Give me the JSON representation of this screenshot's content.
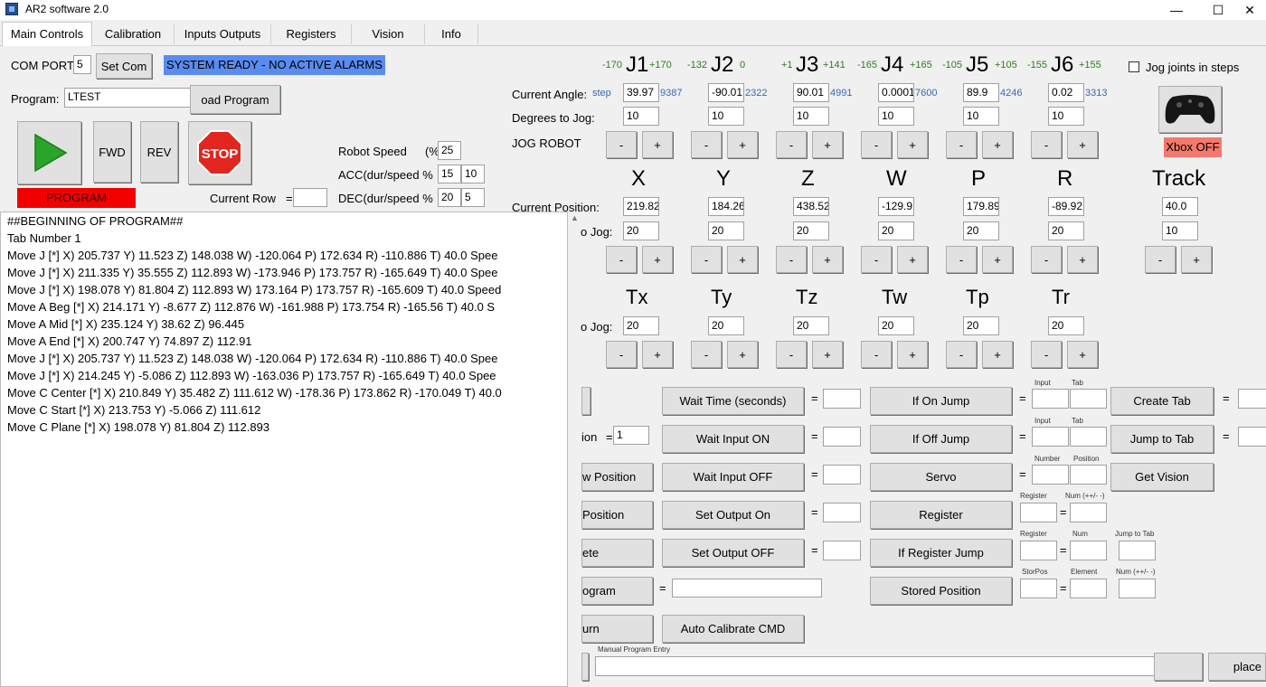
{
  "window": {
    "title": "AR2 software 2.0",
    "minimize": "—",
    "maximize": "☐",
    "close": "✕"
  },
  "tabs": [
    "Main Controls",
    "Calibration",
    "Inputs Outputs",
    "Registers",
    "Vision",
    "Info"
  ],
  "com": {
    "label": "COM PORT",
    "value": "5",
    "button": "Set Com",
    "status": "SYSTEM READY - NO ACTIVE ALARMS"
  },
  "program": {
    "label": "Program:",
    "value": "LTEST",
    "load_button": "oad Program"
  },
  "run": {
    "fwd": "FWD",
    "rev": "REV",
    "stop": "STOP",
    "status": "PROGRAM STOPPED",
    "current_row_label": "Current Row",
    "current_row_eq": "=",
    "current_row_value": ""
  },
  "speed": {
    "speed_label": "Robot Speed",
    "speed_pct": "(%",
    "speed_value": "25",
    "acc_label": "ACC(dur/speed %",
    "acc_dur": "15",
    "acc_speed": "10",
    "dec_label": "DEC(dur/speed %",
    "dec_dur": "20",
    "dec_speed": "5"
  },
  "joints": [
    {
      "name": "J1",
      "min": "-170",
      "max": "+170",
      "angle": "39.97",
      "extra": "9387",
      "jog": "10"
    },
    {
      "name": "J2",
      "min": "-132",
      "max": "0",
      "angle": "-90.01",
      "extra": "2322",
      "jog": "10"
    },
    {
      "name": "J3",
      "min": "+1",
      "max": "+141",
      "angle": "90.01",
      "extra": "4991",
      "jog": "10"
    },
    {
      "name": "J4",
      "min": "-165",
      "max": "+165",
      "angle": "0.0001",
      "extra": "7600",
      "jog": "10"
    },
    {
      "name": "J5",
      "min": "-105",
      "max": "+105",
      "angle": "89.9",
      "extra": "4246",
      "jog": "10"
    },
    {
      "name": "J6",
      "min": "-155",
      "max": "+155",
      "angle": "0.02",
      "extra": "3313",
      "jog": "10"
    }
  ],
  "jog_labels": {
    "current_angle": "Current Angle:",
    "step": "step",
    "degrees_to_jog": "Degrees to Jog:",
    "jog_robot": "JOG ROBOT",
    "minus": "-",
    "plus": "+",
    "jog_steps": "Jog joints in steps",
    "xbox": "Xbox OFF"
  },
  "cartesian": {
    "current_position_label": "Current Position:",
    "to_jog_label": "o Jog:",
    "axes": [
      {
        "name": "X",
        "pos": "219.82",
        "jog": "20"
      },
      {
        "name": "Y",
        "pos": "184.26",
        "jog": "20"
      },
      {
        "name": "Z",
        "pos": "438.52",
        "jog": "20"
      },
      {
        "name": "W",
        "pos": "-129.9",
        "jog": "20"
      },
      {
        "name": "P",
        "pos": "179.89",
        "jog": "20"
      },
      {
        "name": "R",
        "pos": "-89.92",
        "jog": "20"
      }
    ],
    "track": {
      "name": "Track",
      "pos": "40.0",
      "jog": "10"
    }
  },
  "tool": {
    "to_jog_label": "o Jog:",
    "axes": [
      {
        "name": "Tx",
        "jog": "20"
      },
      {
        "name": "Ty",
        "jog": "20"
      },
      {
        "name": "Tz",
        "jog": "20"
      },
      {
        "name": "Tw",
        "jog": "20"
      },
      {
        "name": "Tp",
        "jog": "20"
      },
      {
        "name": "Tr",
        "jog": "20"
      }
    ]
  },
  "program_lines": [
    "##BEGINNING OF PROGRAM##",
    "Tab Number 1",
    "Move J [*]  X) 205.737   Y) 11.523   Z) 148.038   W) -120.064   P) 172.634   R) -110.886   T) 40.0   Spee",
    "Move J [*]  X) 211.335   Y) 35.555   Z) 112.893   W) -173.946   P) 173.757   R) -165.649   T) 40.0   Spee",
    "Move J [*]  X) 198.078   Y) 81.804   Z) 112.893   W) 173.164   P) 173.757   R) -165.609   T) 40.0   Speed",
    "Move A Beg [*]  X) 214.171   Y) -8.677   Z) 112.876   W) -161.988   P) 173.754   R) -165.56   T) 40.0   S",
    "Move A Mid [*]  X) 235.124   Y) 38.62   Z) 96.445",
    "Move A End [*]  X) 200.747   Y) 74.897   Z) 112.91",
    "Move J [*]  X) 205.737   Y) 11.523   Z) 148.038   W) -120.064   P) 172.634   R) -110.886   T) 40.0   Spee",
    "Move J [*]  X) 214.245   Y) -5.086   Z) 112.893   W) -163.036   P) 173.757   R) -165.649   T) 40.0   Spee",
    "Move C Center [*]  X) 210.849   Y) 35.482   Z) 111.612   W) -178.36   P) 173.862   R) -170.049   T) 40.0",
    "Move C Start [*]  X) 213.753   Y) -5.066   Z) 111.612",
    "Move C Plane [*]  X) 198.078   Y) 81.804   Z) 112.893"
  ],
  "commands": {
    "left_col": [
      "ion",
      "w Position",
      "Position",
      "ete",
      "ogram",
      "urn"
    ],
    "left_ion_value": "1",
    "middle_col": [
      "Wait Time (seconds)",
      "Wait Input ON",
      "Wait Input OFF",
      "Set Output On",
      "Set Output OFF",
      "Auto Calibrate CMD"
    ],
    "right_col": [
      "If On Jump",
      "If Off Jump",
      "Servo",
      "Register",
      "If Register Jump",
      "Stored Position"
    ],
    "far_col": [
      "Create Tab",
      "Jump to Tab",
      "Get Vision"
    ],
    "eq": "=",
    "tiny": {
      "input": "Input",
      "tab": "Tab",
      "number": "Number",
      "position": "Position",
      "register": "Register",
      "num_pm": "Num (++/- -)",
      "num": "Num",
      "jump_to_tab": "Jump to Tab",
      "storpos": "StorPos",
      "element": "Element",
      "num_pm2": "Num (++/- -)"
    },
    "manual_entry_label": "Manual Program Entry",
    "replace_button": "place"
  }
}
